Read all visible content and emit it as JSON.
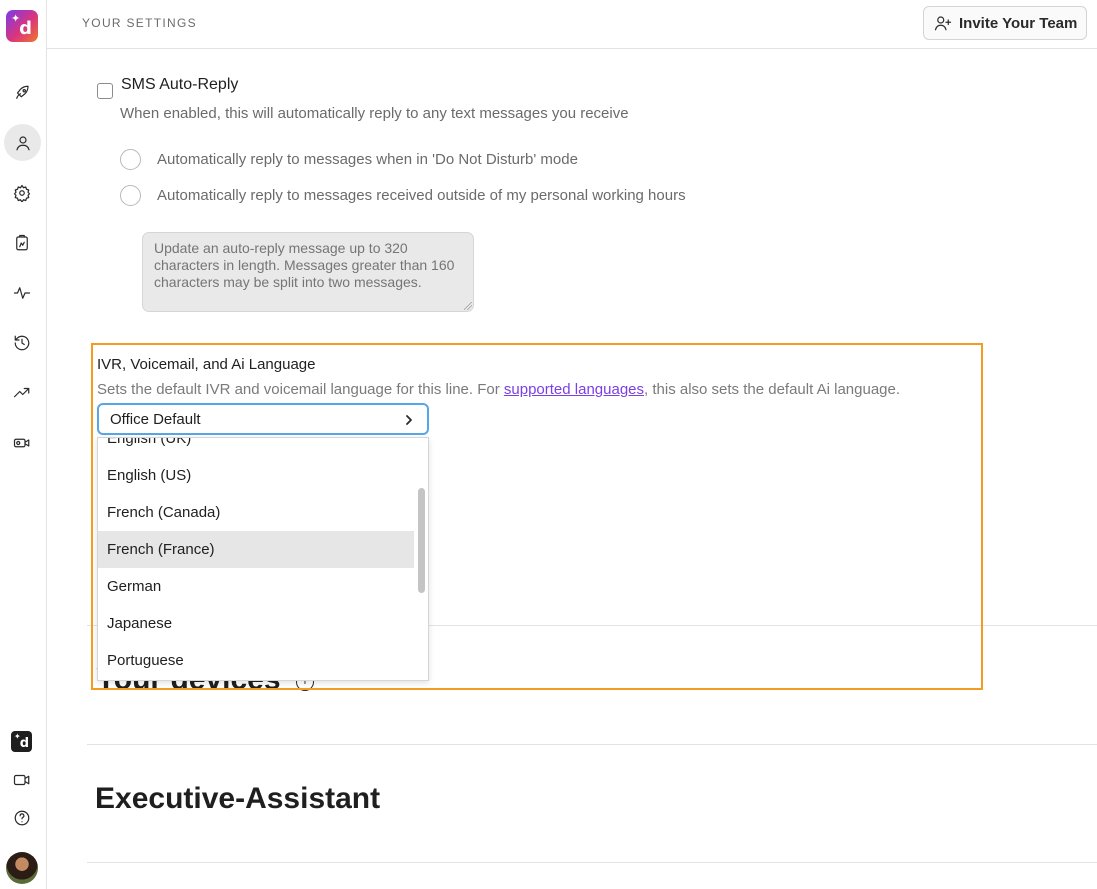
{
  "app": {
    "logo_icon": "dialpad-logo-icon"
  },
  "header": {
    "title": "YOUR SETTINGS",
    "invite_label": "Invite Your Team",
    "invite_icon": "add-user-icon"
  },
  "sidebar": {
    "items": [
      {
        "name": "rocket-icon"
      },
      {
        "name": "user-icon",
        "active": true
      },
      {
        "name": "gear-icon"
      },
      {
        "name": "clipboard-icon"
      },
      {
        "name": "activity-icon"
      },
      {
        "name": "history-icon"
      },
      {
        "name": "trending-up-icon"
      },
      {
        "name": "video-call-icon"
      }
    ],
    "bottom": [
      {
        "name": "dialpad-ai-icon"
      },
      {
        "name": "video-icon"
      },
      {
        "name": "help-icon"
      },
      {
        "name": "avatar"
      }
    ]
  },
  "sms": {
    "label": "SMS Auto-Reply",
    "checked": false,
    "description": "When enabled, this will automatically reply to any text messages you receive",
    "options": [
      "Automatically reply to messages when in 'Do Not Disturb' mode",
      "Automatically reply to messages received outside of my personal working hours"
    ],
    "message_placeholder": "Update an auto-reply message up to 320 characters in length. Messages greater than 160 characters may be split into two messages."
  },
  "language": {
    "title": "IVR, Voicemail, and Ai Language",
    "desc_before": "Sets the default IVR and voicemail language for this line. For ",
    "link": "supported languages",
    "desc_after": ", this also sets the default Ai language.",
    "selected": "Office Default",
    "options": [
      "English (UK)",
      "English (US)",
      "French (Canada)",
      "French (France)",
      "German",
      "Japanese",
      "Portuguese"
    ],
    "hovered": "French (France)",
    "highlight_color": "#f29d1f",
    "link_color": "#7b3fe4",
    "focus_color": "#57a6e8"
  },
  "devices": {
    "title": "Your devices",
    "info_icon": "info-icon"
  },
  "executive": {
    "title": "Executive-Assistant"
  }
}
